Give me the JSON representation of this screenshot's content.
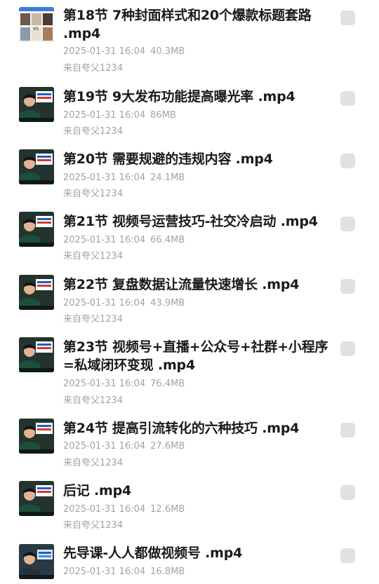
{
  "files": [
    {
      "title": "第18节 7种封面样式和20个爆款标题套路 .mp4",
      "date": "2025-01-31 16:04",
      "size": "40.3MB",
      "source": "来自夸父1234",
      "thumb": "grid"
    },
    {
      "title": "第19节 9大发布功能提高曝光率 .mp4",
      "date": "2025-01-31 16:04",
      "size": "86MB",
      "source": "来自夸父1234",
      "thumb": "lecture"
    },
    {
      "title": "第20节 需要规避的违规内容 .mp4",
      "date": "2025-01-31 16:04",
      "size": "24.1MB",
      "source": "来自夸父1234",
      "thumb": "lecture"
    },
    {
      "title": "第21节 视频号运营技巧-社交冷启动 .mp4",
      "date": "2025-01-31 16:04",
      "size": "66.4MB",
      "source": "来自夸父1234",
      "thumb": "lecture"
    },
    {
      "title": "第22节 复盘数据让流量快速增长 .mp4",
      "date": "2025-01-31 16:04",
      "size": "43.9MB",
      "source": "来自夸父1234",
      "thumb": "lecture"
    },
    {
      "title": "第23节 视频号+直播+公众号+社群+小程序=私域闭环变现 .mp4",
      "date": "2025-01-31 16:04",
      "size": "76.4MB",
      "source": "来自夸父1234",
      "thumb": "lecture"
    },
    {
      "title": "第24节 提高引流转化的六种技巧 .mp4",
      "date": "2025-01-31 16:04",
      "size": "27.6MB",
      "source": "来自夸父1234",
      "thumb": "lecture"
    },
    {
      "title": "后记 .mp4",
      "date": "2025-01-31 16:04",
      "size": "12.6MB",
      "source": "来自夸父1234",
      "thumb": "lecture"
    },
    {
      "title": "先导课-人人都做视频号 .mp4",
      "date": "2025-01-31 16:04",
      "size": "16.8MB",
      "source": "来自夸父1234",
      "thumb": "lecture"
    }
  ],
  "colors": {
    "title": "#1a1a1a",
    "meta": "#a3a3a3",
    "checkbox": "#e1e1e1"
  },
  "icons": {
    "checkbox": "checkbox-icon",
    "thumbnail": "video-thumbnail"
  }
}
